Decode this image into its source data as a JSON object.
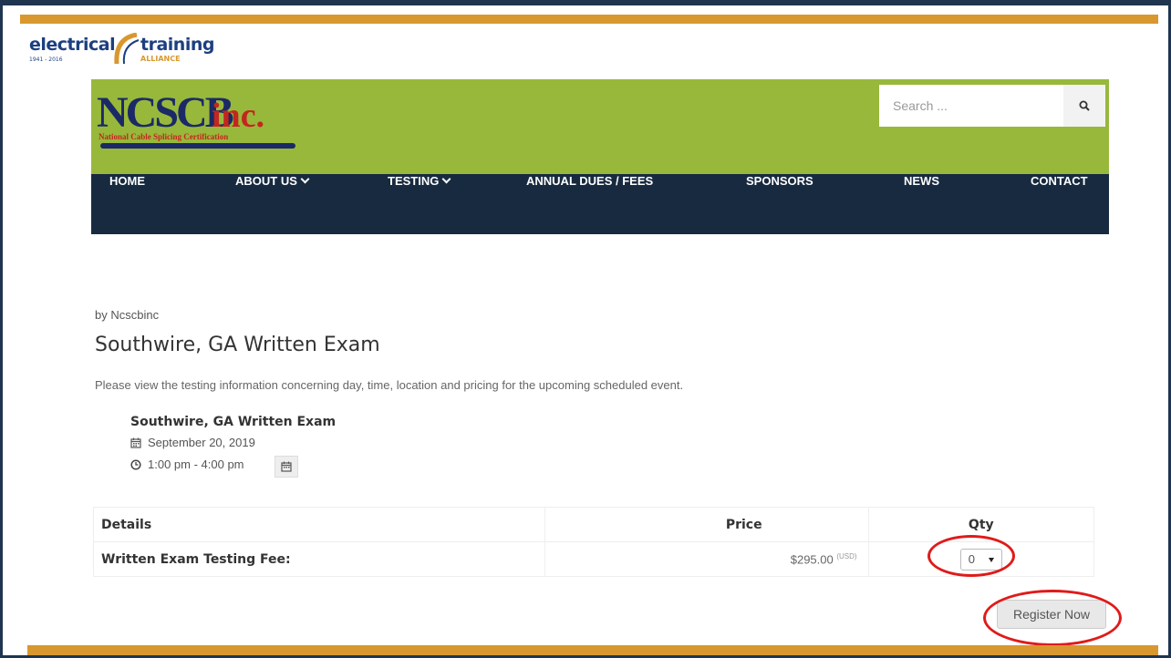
{
  "eta_logo": {
    "word1": "electrical",
    "word2": "training",
    "word3": "ALLIANCE",
    "years": "1941 - 2016"
  },
  "brand": {
    "name": "NCSCB",
    "suffix": "inc.",
    "tagline": "National Cable Splicing Certification"
  },
  "search": {
    "placeholder": "Search ..."
  },
  "nav": [
    {
      "label": "HOME",
      "has_dropdown": false
    },
    {
      "label": "ABOUT US",
      "has_dropdown": true
    },
    {
      "label": "TESTING",
      "has_dropdown": true
    },
    {
      "label": "ANNUAL DUES / FEES",
      "has_dropdown": false
    },
    {
      "label": "SPONSORS",
      "has_dropdown": false
    },
    {
      "label": "NEWS",
      "has_dropdown": false
    },
    {
      "label": "CONTACT",
      "has_dropdown": false
    }
  ],
  "event": {
    "author": "by Ncscbinc",
    "title": "Southwire, GA Written Exam",
    "intro": "Please view the testing information concerning day, time, location and pricing for the upcoming scheduled event.",
    "name": "Southwire, GA Written Exam",
    "date": "September 20, 2019",
    "time": "1:00 pm - 4:00 pm"
  },
  "tickets": {
    "headers": {
      "details": "Details",
      "price": "Price",
      "qty": "Qty"
    },
    "rows": [
      {
        "name": "Written Exam Testing Fee:",
        "price": "$295.00",
        "currency": "(USD)",
        "qty": "0"
      }
    ]
  },
  "register_label": "Register Now",
  "colors": {
    "gold": "#d8982f",
    "navy": "#1f3550",
    "site_green": "#98b83c",
    "nav_bg": "#172a40",
    "brand_blue": "#1b2a66",
    "brand_red": "#c4261e",
    "annotation_red": "#e01a1a"
  },
  "icons": {
    "search": "search-icon",
    "calendar": "calendar-icon",
    "clock": "clock-icon",
    "select_arrow": "caret-down-icon"
  }
}
